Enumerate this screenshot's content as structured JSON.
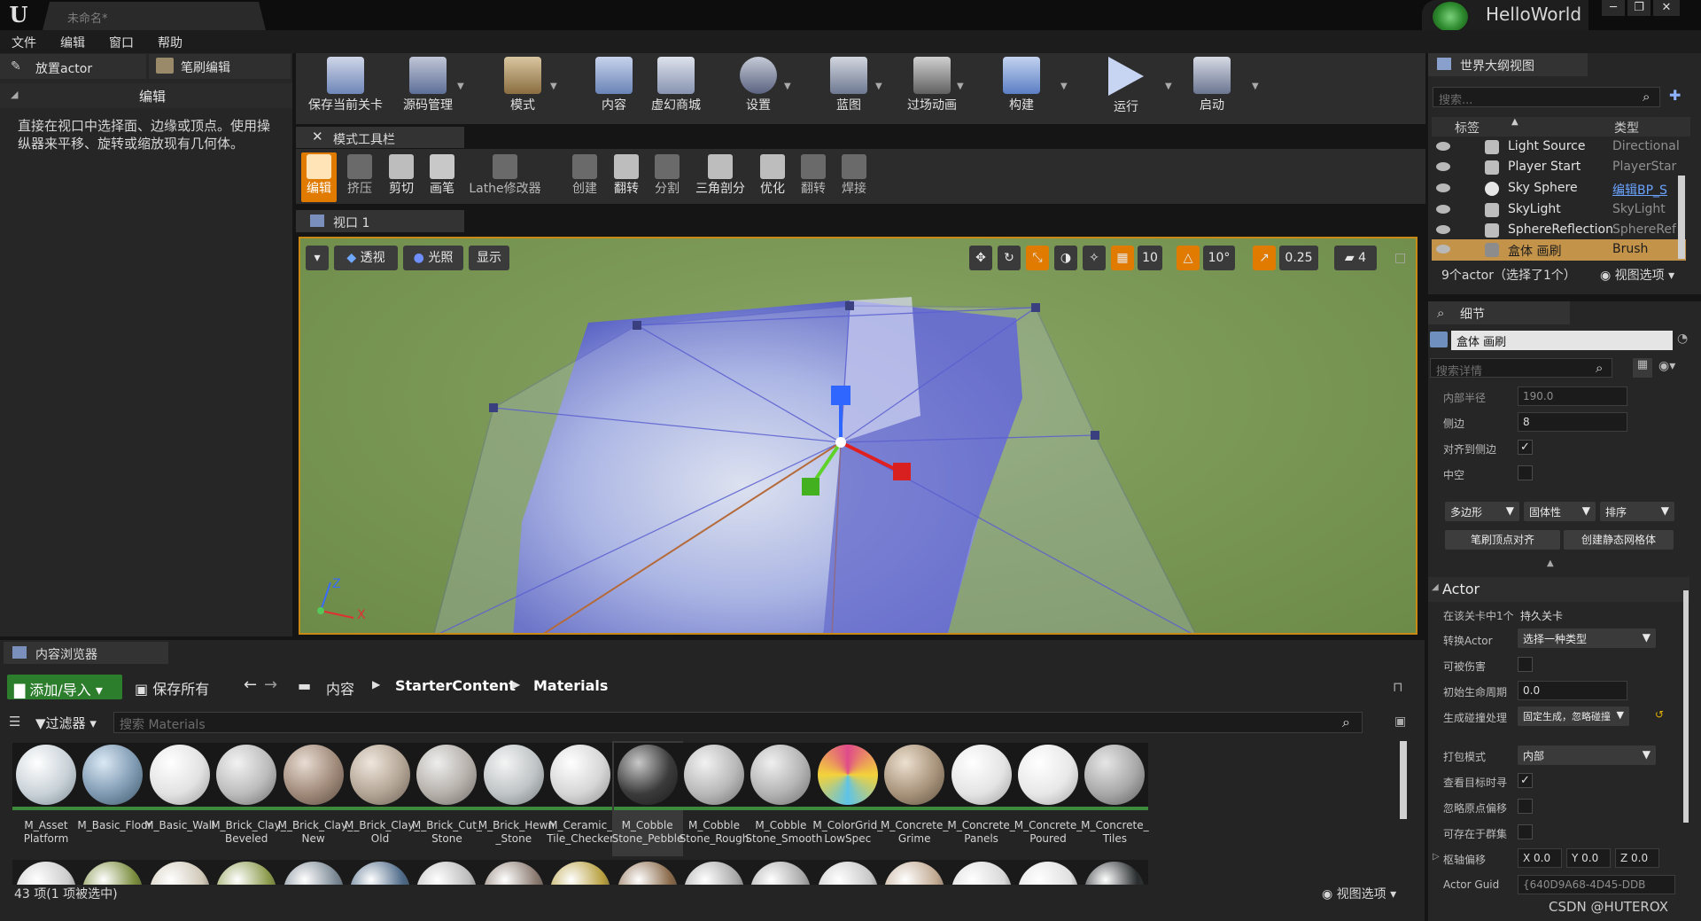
{
  "title_bar": {
    "doc_title": "未命名*",
    "project_name": "HelloWorld",
    "window_buttons": [
      "─",
      "❐",
      "✕"
    ]
  },
  "menu": [
    "文件",
    "编辑",
    "窗口",
    "帮助"
  ],
  "left_panel": {
    "tabs": [
      "放置actor",
      "笔刷编辑"
    ],
    "section_title": "编辑",
    "description": "直接在视口中选择面、边缘或顶点。使用操纵器来平移、旋转或缩放现有几何体。"
  },
  "toolbar": {
    "buttons": [
      "保存当前关卡",
      "源码管理",
      "模式",
      "内容",
      "虚幻商城",
      "设置",
      "蓝图",
      "过场动画",
      "构建",
      "运行",
      "启动"
    ]
  },
  "mode_toolbar": {
    "tab": "模式工具栏",
    "buttons": [
      "编辑",
      "挤压",
      "剪切",
      "画笔",
      "Lathe修改器",
      "创建",
      "翻转",
      "分割",
      "三角剖分",
      "优化",
      "翻转",
      "焊接"
    ]
  },
  "viewport": {
    "tab": "视口 1",
    "view_mode": "透视",
    "lighting": "光照",
    "show": "显示",
    "grid_snap": "10",
    "rotation_snap": "10°",
    "scale_snap": "0.25",
    "camera_speed": "4",
    "axis_labels": [
      "Z",
      "X"
    ]
  },
  "outliner": {
    "tab": "世界大纲视图",
    "search_placeholder": "搜索...",
    "col_label": "标签",
    "col_type": "类型",
    "rows": [
      {
        "name": "Light Source",
        "type": "Directional"
      },
      {
        "name": "Player Start",
        "type": "PlayerStar"
      },
      {
        "name": "Sky Sphere",
        "type": "编辑BP_S"
      },
      {
        "name": "SkyLight",
        "type": "SkyLight"
      },
      {
        "name": "SphereReflection",
        "type": "SphereRef"
      },
      {
        "name": "盒体 画刷",
        "type": "Brush"
      }
    ],
    "status": "9个actor（选择了1个）",
    "view_options": "视图选项"
  },
  "details": {
    "tab": "细节",
    "object_name": "盒体 画刷",
    "search_placeholder": "搜索详情",
    "props": [
      {
        "label": "内部半径",
        "value": "190.0"
      },
      {
        "label": "侧边",
        "value": "8"
      },
      {
        "label": "对齐到侧边",
        "value": "✓"
      },
      {
        "label": "中空",
        "value": ""
      }
    ],
    "combos": [
      "多边形",
      "固体性",
      "排序"
    ],
    "buttons": [
      "笔刷顶点对齐",
      "创建静态网格体"
    ],
    "actor_section": "Actor",
    "actor_props": [
      {
        "label": "在该关卡中1个",
        "value": "持久关卡"
      },
      {
        "label": "转换Actor",
        "value": "选择一种类型"
      },
      {
        "label": "可被伤害",
        "value": ""
      },
      {
        "label": "初始生命周期",
        "value": "0.0"
      },
      {
        "label": "生成碰撞处理",
        "value": "固定生成，忽略碰撞"
      },
      {
        "label": "打包模式",
        "value": "内部"
      },
      {
        "label": "查看目标时寻",
        "value": "✓"
      },
      {
        "label": "忽略原点偏移",
        "value": ""
      },
      {
        "label": "可存在于群集",
        "value": ""
      },
      {
        "label": "枢轴偏移",
        "value": ""
      },
      {
        "label": "Actor Guid",
        "value": "{640D9A68-4D45-DDB"
      }
    ],
    "pivot": [
      "X 0.0",
      "Y 0.0",
      "Z 0.0"
    ]
  },
  "content_browser": {
    "tab": "内容浏览器",
    "add_import": "添加/导入",
    "save_all": "保存所有",
    "path": [
      "内容",
      "StarterContent",
      "Materials"
    ],
    "filter": "过滤器",
    "search_placeholder": "搜索 Materials",
    "assets": [
      "M_Asset Platform",
      "M_Basic_Floor",
      "M_Basic_Wall",
      "M_Brick_Clay_ Beveled",
      "M_Brick_Clay_ New",
      "M_Brick_Clay_ Old",
      "M_Brick_Cut_ Stone",
      "M_Brick_Hewn _Stone",
      "M_Ceramic_ Tile_Checker",
      "M_Cobble Stone_Pebble",
      "M_Cobble Stone_Rough",
      "M_Cobble Stone_Smooth",
      "M_ColorGrid_ LowSpec",
      "M_Concrete_ Grime",
      "M_Concrete_ Panels",
      "M_Concrete_ Poured",
      "M_Concrete_ Tiles"
    ],
    "status": "43 项(1 项被选中)",
    "view_options": "视图选项"
  },
  "watermark": "CSDN @HUTEROX"
}
